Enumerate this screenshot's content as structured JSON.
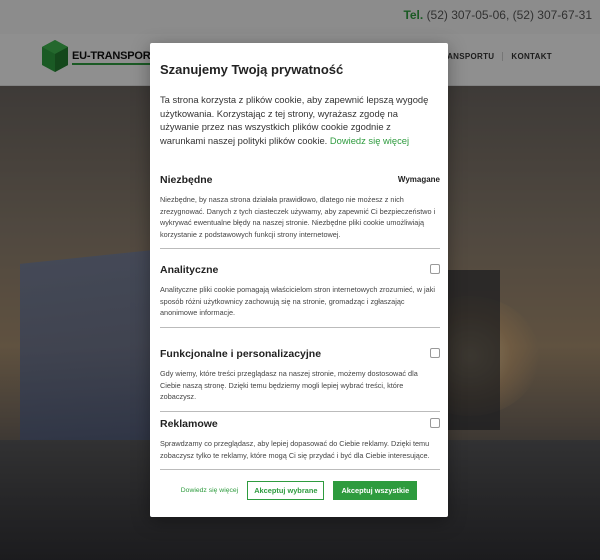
{
  "site": {
    "phone_label": "Tel.",
    "phone_numbers": "(52) 307-05-06, (52) 307-67-31",
    "brand": "EU-TRANSPORT",
    "nav": [
      "A TRANSPORTU",
      "KONTAKT"
    ]
  },
  "modal": {
    "title": "Szanujemy Twoją prywatność",
    "intro": "Ta strona korzysta z plików cookie, aby zapewnić lepszą wygodę użytkowania. Korzystając z tej strony, wyrażasz zgodę na używanie przez nas wszystkich plików cookie zgodnie z warunkami naszej polityki plików cookie.",
    "intro_link": "Dowiedz się więcej",
    "sections": [
      {
        "title": "Niezbędne",
        "required_label": "Wymagane",
        "text": "Niezbędne, by nasza strona działała prawidłowo, dlatego nie możesz z nich zrezygnować. Danych z tych ciasteczek używamy, aby zapewnić Ci bezpieczeństwo i wykrywać ewentualne błędy na naszej stronie. Niezbędne pliki cookie umożliwiają korzystanie z podstawowych funkcji strony internetowej."
      },
      {
        "title": "Analityczne",
        "text": "Analityczne pliki cookie pomagają właścicielom stron internetowych zrozumieć, w jaki sposób różni użytkownicy zachowują się na stronie, gromadząc i zgłaszając anonimowe informacje."
      },
      {
        "title": "Funkcjonalne i personalizacyjne",
        "text": "Gdy wiemy, które treści przeglądasz na naszej stronie, możemy dostosować dla Ciebie naszą stronę. Dzięki temu będziemy mogli lepiej wybrać treści, które zobaczysz."
      },
      {
        "title": "Reklamowe",
        "text": "Sprawdzamy co przeglądasz, aby lepiej dopasować do Ciebie reklamy. Dzięki temu zobaczysz tylko te reklamy, które mogą Ci się przydać i być dla Ciebie interesujące."
      }
    ],
    "buttons": {
      "learn_more": "Dowiedz się więcej",
      "accept_selected": "Akceptuj wybrane",
      "accept_all": "Akceptuj wszystkie"
    }
  },
  "colors": {
    "accent": "#2e9b3e"
  }
}
